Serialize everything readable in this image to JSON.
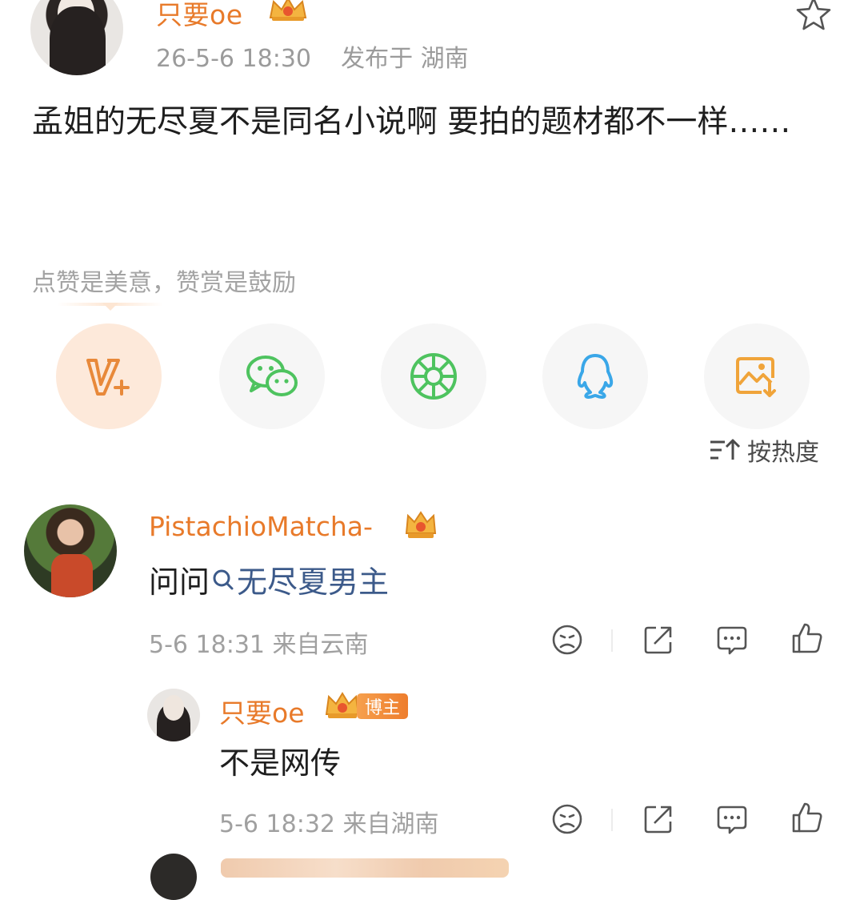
{
  "post": {
    "author": "只要oe",
    "timestamp": "26-5-6 18:30",
    "location": "发布于 湖南",
    "content": "孟姐的无尽夏不是同名小说啊 要拍的题材都不一样……",
    "reward_prompt": "点赞是美意，赞赏是鼓励"
  },
  "share_options": [
    "v-plus-icon",
    "wechat-icon",
    "moments-icon",
    "qq-icon",
    "save-image-icon"
  ],
  "sort": {
    "label": "按热度"
  },
  "comments": [
    {
      "author": "PistachioMatcha-",
      "text_prefix": "问问",
      "search_term": "无尽夏男主",
      "meta": "5-6 18:31 来自云南"
    }
  ],
  "reply": {
    "author": "只要oe",
    "badge": "博主",
    "text": "不是网传",
    "meta": "5-6 18:32 来自湖南"
  },
  "colors": {
    "username": "#e87a2a",
    "link": "#3c5a8a",
    "meta": "#a0a0a0",
    "v_accent": "#e8893a",
    "wechat": "#4ec35f",
    "qq": "#3aa7e8",
    "save": "#f0a43a"
  }
}
